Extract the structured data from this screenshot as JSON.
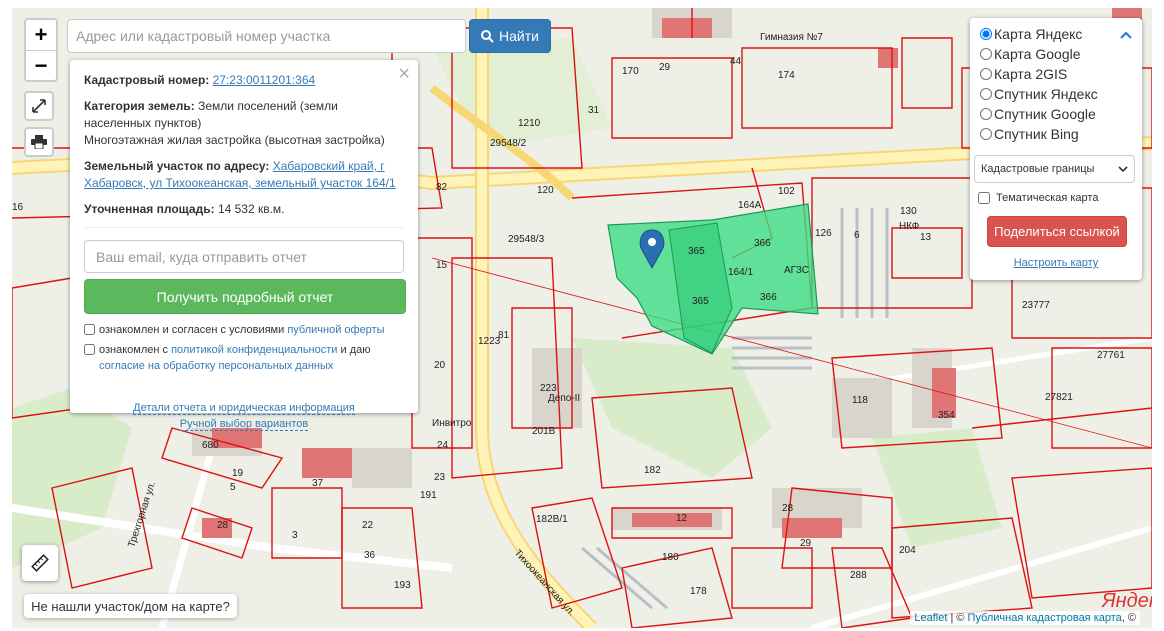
{
  "search": {
    "placeholder": "Адрес или кадастровый номер участка",
    "button_label": "Найти"
  },
  "zoom": {
    "in": "+",
    "out": "−"
  },
  "info": {
    "cadastral_label": "Кадастровый номер:",
    "cadastral_value": "27:23:0011201:364",
    "category_label": "Категория земель:",
    "category_value": "Земли поселений (земли населенных пунктов)",
    "use_value": "Многоэтажная жилая застройка (высотная застройка)",
    "address_label": "Земельный участок по адресу:",
    "address_value": "Хабаровский край, г Хабаровск, ул Тихоокеанская, земельный участок 164/1",
    "area_label": "Уточненная площадь:",
    "area_value": "14 532 кв.м.",
    "close": "×",
    "email_placeholder": "Ваш email, куда отправить отчет",
    "report_button": "Получить подробный отчет",
    "agree1_text": "ознакомлен и согласен с условиями",
    "agree1_link": "публичной оферты",
    "agree2_text": "ознакомлен с",
    "agree2_link": "политикой конфиденциальности",
    "agree2_mid": "и даю",
    "agree2_link2": "согласие на обработку персональных данных",
    "details_link": "Детали отчета и юридическая информация",
    "manual_link": "Ручной выбор вариантов"
  },
  "layers": {
    "options": [
      "Карта Яндекс",
      "Карта Google",
      "Карта 2GIS",
      "Спутник Яндекс",
      "Спутник Google",
      "Спутник Bing"
    ],
    "selected": "Карта Яндекс",
    "boundaries_select": "Кадастровые границы",
    "thematic": "Тематическая карта",
    "share": "Поделиться ссылкой",
    "configure": "Настроить карту"
  },
  "notfound": "Не нашли участок/дом на карте?",
  "attribution": {
    "leaflet": "Leaflet",
    "sep": "| ©",
    "pkk": "Публичная кадастровая карта",
    "tail": ", ©"
  },
  "yandex_logo": "Яндекс",
  "map_labels": {
    "street1": "Трехгорная ул.",
    "street2": "Тихоокеанская ул.",
    "poi1": "АГЗС",
    "poi2": "Депо-II",
    "poi3": "Инвитро",
    "poi4": "НКФ",
    "poi5": "Гимназия №7",
    "parcels": [
      "365",
      "366",
      "365",
      "366",
      "164/1",
      "164А",
      "102",
      "126",
      "6",
      "13",
      "130",
      "23777",
      "27761",
      "27821",
      "354",
      "118",
      "182",
      "12",
      "29",
      "28",
      "204",
      "288",
      "24",
      "23",
      "20",
      "15",
      "16",
      "223",
      "81",
      "1223",
      "1210",
      "29548/3",
      "29548/2",
      "120",
      "82",
      "44",
      "174",
      "170",
      "31",
      "29",
      "5",
      "19",
      "28",
      "3",
      "37",
      "680",
      "22",
      "36",
      "193",
      "191",
      "201В",
      "182В/1",
      "180",
      "178"
    ]
  },
  "colors": {
    "parcel_fill": "#3ddc84",
    "parcel_line": "#d11",
    "button_blue": "#337ab7",
    "button_green": "#5cb85c",
    "button_red": "#d9534f"
  }
}
